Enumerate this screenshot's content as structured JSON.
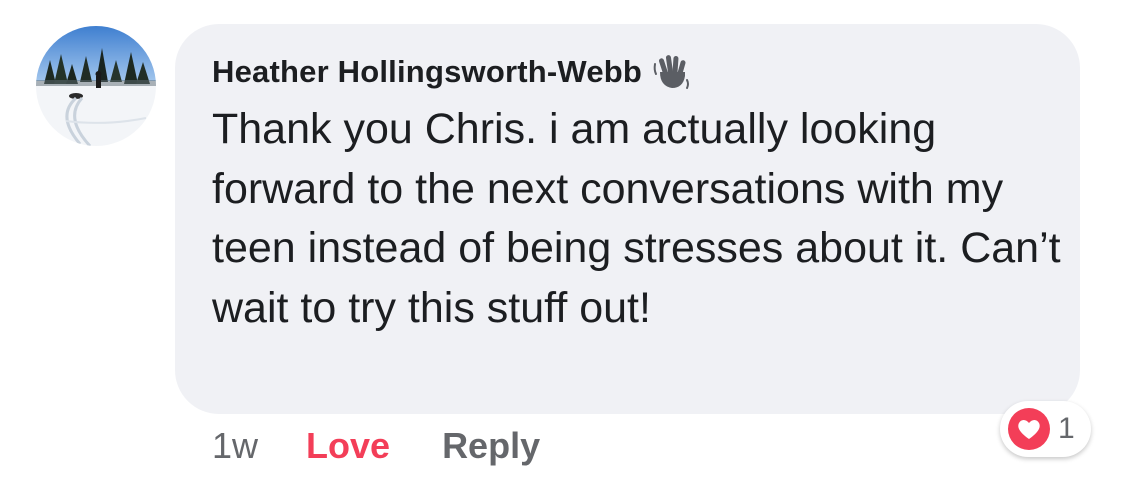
{
  "comment": {
    "author": "Heather Hollingsworth-Webb",
    "author_badge_icon": "waving-hand-icon",
    "text": "Thank you Chris.  i am actually looking forward to the next conversations with my teen instead of being stresses about it.  Can’t wait to try this stuff out!",
    "timestamp": "1w",
    "avatar_icon": "snowy-landscape-photo"
  },
  "actions": {
    "love_label": "Love",
    "reply_label": "Reply"
  },
  "reactions": {
    "icon": "heart-icon",
    "count": "1"
  },
  "colors": {
    "bubble_bg": "#f0f1f5",
    "love_red": "#f33e58",
    "muted_text": "#65676b",
    "primary_text": "#1c1e21"
  }
}
